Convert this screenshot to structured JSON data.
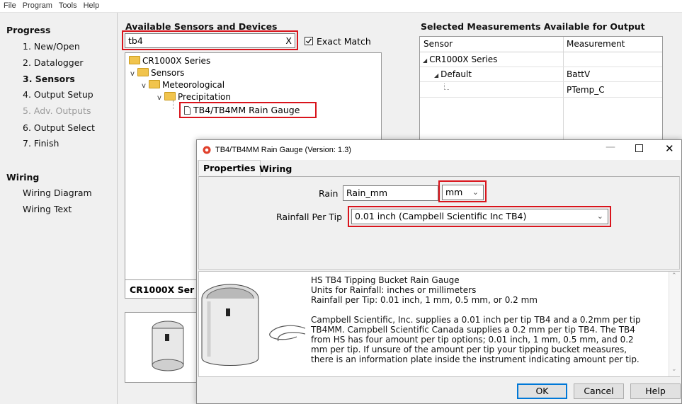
{
  "menu": [
    "File",
    "Program",
    "Tools",
    "Help"
  ],
  "progress": {
    "title": "Progress",
    "steps": [
      "1. New/Open",
      "2. Datalogger",
      "3. Sensors",
      "4. Output Setup",
      "5. Adv. Outputs",
      "6. Output Select",
      "7. Finish"
    ]
  },
  "wiring": {
    "title": "Wiring",
    "items": [
      "Wiring Diagram",
      "Wiring Text"
    ]
  },
  "available": {
    "heading": "Available Sensors and Devices",
    "search_value": "tb4",
    "clear_label": "X",
    "exact_match_label": "Exact Match",
    "tree": [
      "CR1000X Series",
      "Sensors",
      "Meteorological",
      "Precipitation",
      "TB4/TB4MM Rain Gauge"
    ],
    "tab_label": "CR1000X Ser"
  },
  "selected": {
    "heading": "Selected Measurements Available for Output",
    "columns": [
      "Sensor",
      "Measurement"
    ],
    "rows": [
      {
        "sensor": "CR1000X Series",
        "measurement": ""
      },
      {
        "sensor": "Default",
        "measurement": "BattV"
      },
      {
        "sensor": "",
        "measurement": "PTemp_C"
      }
    ]
  },
  "dialog": {
    "title": "TB4/TB4MM Rain Gauge (Version: 1.3)",
    "tabs": [
      "Properties",
      "Wiring"
    ],
    "rain_label": "Rain",
    "rain_value": "Rain_mm",
    "units_value": "mm",
    "rainfall_label": "Rainfall Per Tip",
    "rainfall_value": "0.01 inch (Campbell Scientific Inc TB4)",
    "description": {
      "line1": "HS TB4 Tipping Bucket Rain Gauge",
      "line2": "Units for Rainfall: inches or millimeters",
      "line3": "Rainfall per Tip: 0.01 inch, 1 mm, 0.5 mm, or 0.2 mm",
      "para": "Campbell Scientific, Inc. supplies a 0.01 inch per tip TB4 and a 0.2mm per tip\nTB4MM. Campbell Scientific Canada supplies a 0.2 mm per tip TB4. The TB4\nfrom HS has four amount per tip options; 0.01 inch, 1 mm, 0.5 mm, and 0.2\nmm per tip. If unsure of the amount per tip your tipping bucket measures,\nthere is an information plate inside the instrument indicating amount per tip."
    },
    "buttons": {
      "ok": "OK",
      "cancel": "Cancel",
      "help": "Help"
    }
  },
  "colors": {
    "highlight": "#d9141c",
    "accent": "#0078d7"
  }
}
